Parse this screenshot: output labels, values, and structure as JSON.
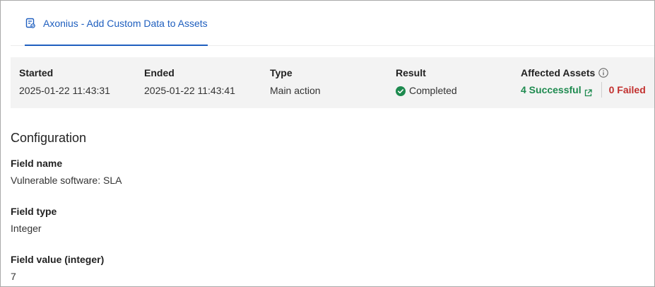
{
  "tab": {
    "label": "Axonius - Add Custom Data to Assets",
    "icon": "enforcement-doc-icon",
    "accent": "#1f5fbf"
  },
  "summary": {
    "started": {
      "label": "Started",
      "value": "2025-01-22 11:43:31"
    },
    "ended": {
      "label": "Ended",
      "value": "2025-01-22 11:43:41"
    },
    "type": {
      "label": "Type",
      "value": "Main action"
    },
    "result": {
      "label": "Result",
      "value": "Completed",
      "icon": "check-circle-icon",
      "color": "#1e8a4f"
    },
    "affected": {
      "label": "Affected Assets",
      "info_icon": "info-icon",
      "successful": "4 Successful",
      "successful_color": "#1e8a4f",
      "failed": "0 Failed",
      "failed_color": "#c2302e"
    }
  },
  "configuration": {
    "title": "Configuration",
    "fields": [
      {
        "label": "Field name",
        "value": "Vulnerable software: SLA"
      },
      {
        "label": "Field type",
        "value": "Integer"
      },
      {
        "label": "Field value (integer)",
        "value": "7"
      }
    ]
  }
}
